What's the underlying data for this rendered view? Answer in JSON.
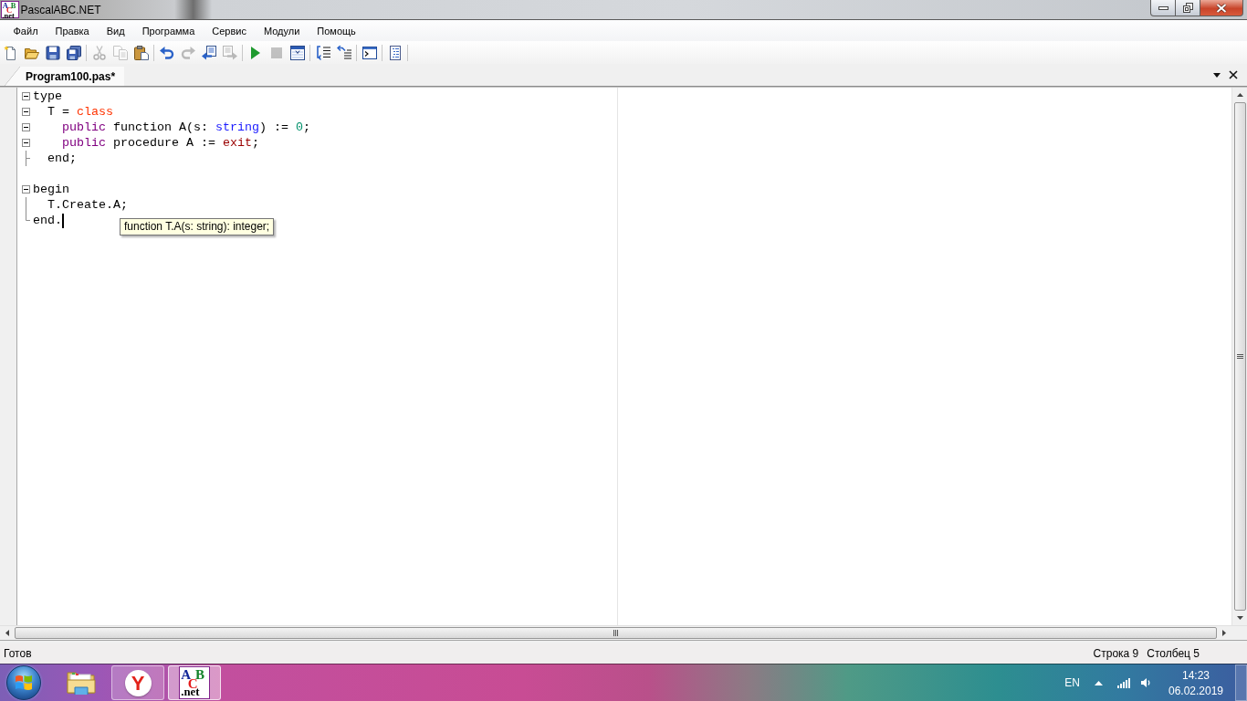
{
  "window": {
    "title": "PascalABC.NET",
    "logo_letters": [
      "A",
      "B",
      "C",
      ".net"
    ]
  },
  "menu": [
    "Файл",
    "Правка",
    "Вид",
    "Программа",
    "Сервис",
    "Модули",
    "Помощь"
  ],
  "toolbar": [
    [
      {
        "kind": "new",
        "disabled": false
      },
      {
        "kind": "open",
        "disabled": false
      },
      {
        "kind": "save",
        "disabled": false
      },
      {
        "kind": "save-all",
        "disabled": false
      }
    ],
    [
      {
        "kind": "cut",
        "disabled": true
      },
      {
        "kind": "copy",
        "disabled": true
      },
      {
        "kind": "paste",
        "disabled": false
      }
    ],
    [
      {
        "kind": "undo",
        "disabled": false
      },
      {
        "kind": "redo",
        "disabled": true
      },
      {
        "kind": "doc-left",
        "disabled": false
      },
      {
        "kind": "doc-right",
        "disabled": true
      }
    ],
    [
      {
        "kind": "run",
        "disabled": false
      },
      {
        "kind": "stop",
        "disabled": true
      },
      {
        "kind": "grid",
        "disabled": false
      }
    ],
    [
      {
        "kind": "step-into",
        "disabled": false
      },
      {
        "kind": "step-over",
        "disabled": false
      }
    ],
    [
      {
        "kind": "console",
        "disabled": false
      }
    ],
    [
      {
        "kind": "outline",
        "disabled": false
      }
    ]
  ],
  "tabs": [
    {
      "label": "Program100.pas*",
      "selected": true
    }
  ],
  "editor": {
    "lines": [
      {
        "kind": "block",
        "caret": false,
        "tokens": [
          {
            "kind": "plain",
            "text": "type"
          }
        ]
      },
      {
        "kind": "block",
        "caret": false,
        "tokens": [
          {
            "kind": "plain",
            "text": "  T = "
          },
          {
            "kind": "reserved",
            "text": "class"
          }
        ]
      },
      {
        "kind": "block",
        "caret": false,
        "tokens": [
          {
            "kind": "modifier",
            "text": "    public"
          },
          {
            "kind": "plain",
            "text": " function A(s: "
          },
          {
            "kind": "type",
            "text": "string"
          },
          {
            "kind": "plain",
            "text": ") := "
          },
          {
            "kind": "number",
            "text": "0"
          },
          {
            "kind": "plain",
            "text": ";"
          }
        ]
      },
      {
        "kind": "block",
        "caret": false,
        "tokens": [
          {
            "kind": "modifier",
            "text": "    public"
          },
          {
            "kind": "plain",
            "text": " procedure A := "
          },
          {
            "kind": "builtin",
            "text": "exit"
          },
          {
            "kind": "plain",
            "text": ";"
          }
        ]
      },
      {
        "kind": "branch",
        "caret": false,
        "tokens": [
          {
            "kind": "plain",
            "text": "  end;"
          }
        ]
      },
      {
        "kind": "plain",
        "caret": false
      },
      {
        "kind": "block",
        "caret": false,
        "tokens": [
          {
            "kind": "plain",
            "text": "begin"
          }
        ]
      },
      {
        "kind": "guide",
        "caret": false,
        "tokens": [
          {
            "kind": "plain",
            "text": "  T.Create.A;"
          }
        ]
      },
      {
        "kind": "last",
        "caret": true,
        "tokens": [
          {
            "kind": "plain",
            "text": "end."
          }
        ]
      }
    ],
    "tooltip": "function T.A(s: string): integer;"
  },
  "status_bar": {
    "message": "Готов",
    "line": "Строка 9",
    "column": "Столбец 5"
  },
  "taskbar": {
    "apps": [
      {
        "kind": "folder",
        "running": false,
        "selected": false
      },
      {
        "kind": "browser",
        "logo_text": "Y",
        "running": true,
        "selected": false
      },
      {
        "kind": "abc",
        "logo_letters": [
          "A",
          "B",
          "C",
          ".net"
        ],
        "running": true,
        "selected": true
      }
    ],
    "language": "EN",
    "time": "14:23",
    "date": "06.02.2019"
  }
}
